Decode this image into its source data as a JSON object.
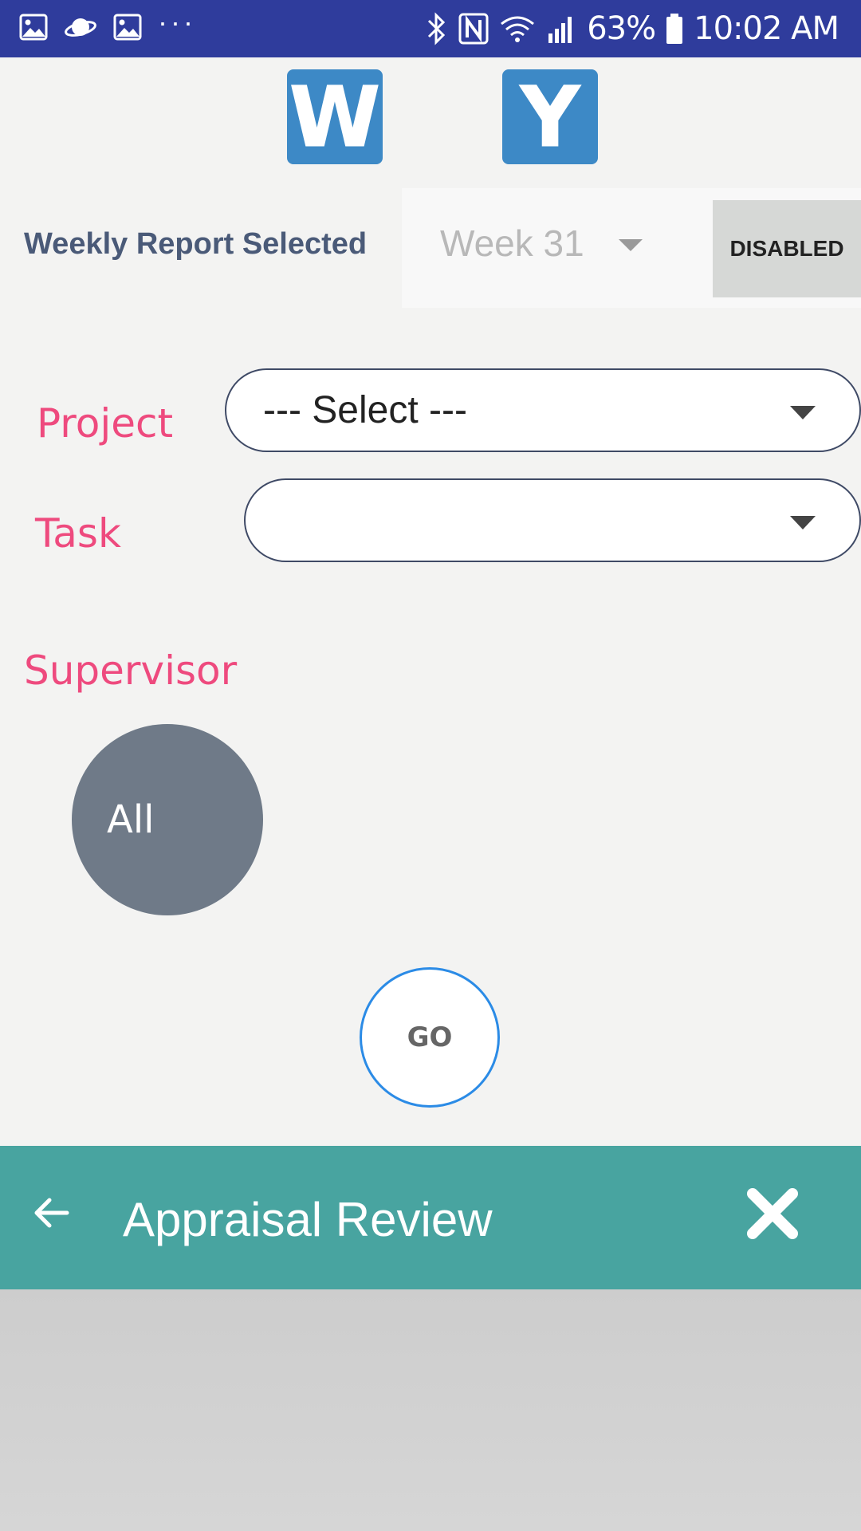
{
  "status_bar": {
    "battery": "63%",
    "time": "10:02 AM",
    "overflow": "···",
    "icons": [
      "image-icon",
      "saturn-icon",
      "image-icon",
      "bluetooth-icon",
      "nfc-icon",
      "wifi-icon",
      "signal-icon",
      "battery-icon"
    ]
  },
  "report_toggle": {
    "weekly_letter": "W",
    "yearly_letter": "Y"
  },
  "week_row": {
    "label": "Weekly Report Selected",
    "selected_week": "Week 31",
    "disabled_label": "DISABLED"
  },
  "form": {
    "project_label": "Project",
    "project_value": "--- Select ---",
    "task_label": "Task",
    "task_value": "",
    "supervisor_label": "Supervisor",
    "supervisor_option": "All",
    "go_label": "GO"
  },
  "appbar": {
    "title": "Appraisal Review"
  },
  "colors": {
    "status_bar": "#2f3c9c",
    "toggle": "#3d89c6",
    "label_pink": "#ee4a7e",
    "appbar": "#48a4a0",
    "go_border": "#2b8be6",
    "all_circle": "#6f7a88"
  }
}
